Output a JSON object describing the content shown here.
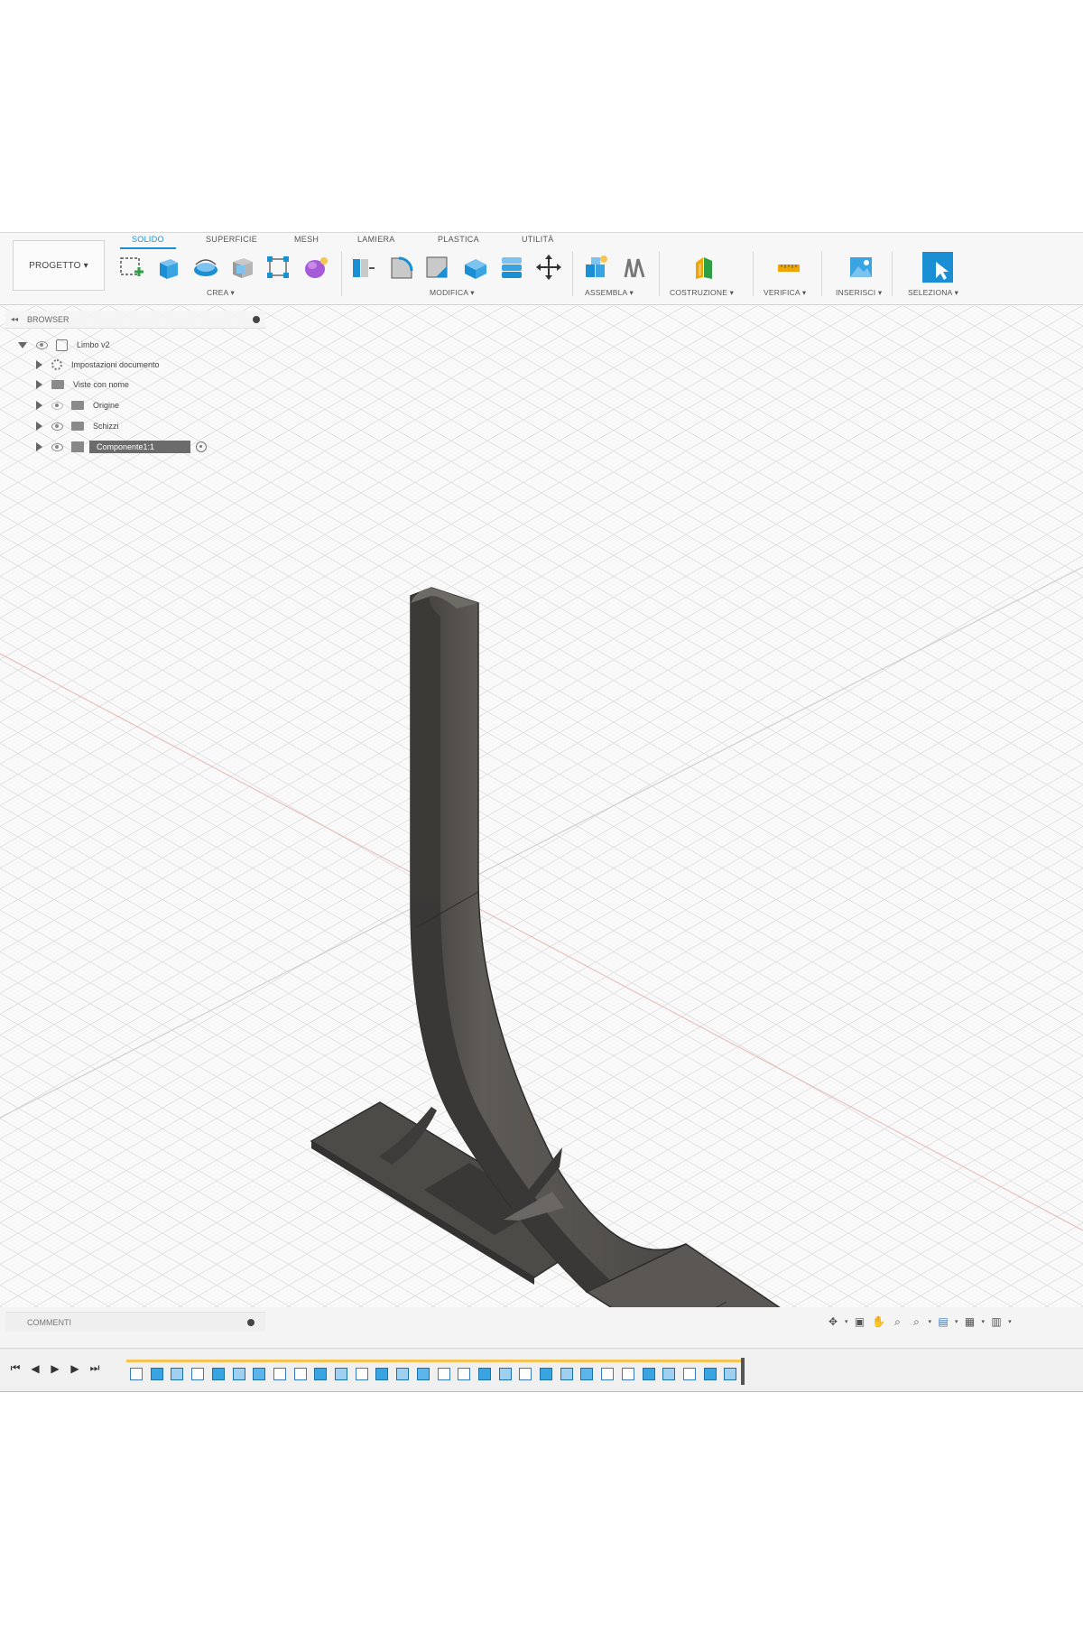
{
  "toolbar": {
    "project_label": "PROGETTO ▾",
    "tabs": [
      "SOLIDO",
      "SUPERFICIE",
      "MESH",
      "LAMIERA",
      "PLASTICA",
      "UTILITÀ"
    ],
    "groups": [
      "CREA ▾",
      "MODIFICA ▾",
      "ASSEMBLA ▾",
      "COSTRUZIONE ▾",
      "VERIFICA ▾",
      "INSERISCI ▾",
      "SELEZIONA ▾"
    ],
    "accent_color": "#1a8fd4"
  },
  "browser": {
    "header": "BROWSER",
    "root": "Limbo v2",
    "items": [
      "Impostazioni documento",
      "Viste con nome",
      "Origine",
      "Schizzi",
      "Componente1:1"
    ]
  },
  "comments": {
    "label": "COMMENTI"
  },
  "model": {
    "color": "#5b5854"
  }
}
